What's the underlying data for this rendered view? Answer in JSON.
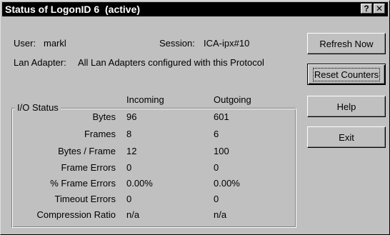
{
  "window": {
    "title": "Status of LogonID 6  (active)",
    "help_glyph": "?",
    "close_glyph": "✕"
  },
  "info": {
    "user_label": "User:",
    "user_value": "markl",
    "session_label": "Session:",
    "session_value": "ICA-ipx#10",
    "lan_label": "Lan Adapter:",
    "lan_value": "All Lan Adapters configured with this Protocol"
  },
  "io_status": {
    "title": "I/O Status",
    "col_incoming": "Incoming",
    "col_outgoing": "Outgoing",
    "rows": [
      {
        "label": "Bytes",
        "incoming": "96",
        "outgoing": "601"
      },
      {
        "label": "Frames",
        "incoming": "8",
        "outgoing": "6"
      },
      {
        "label": "Bytes / Frame",
        "incoming": "12",
        "outgoing": "100"
      },
      {
        "label": "Frame Errors",
        "incoming": "0",
        "outgoing": "0"
      },
      {
        "label": "% Frame Errors",
        "incoming": "0.00%",
        "outgoing": "0.00%"
      },
      {
        "label": "Timeout Errors",
        "incoming": "0",
        "outgoing": "0"
      },
      {
        "label": "Compression Ratio",
        "incoming": "n/a",
        "outgoing": "n/a"
      }
    ]
  },
  "buttons": {
    "refresh": "Refresh Now",
    "reset": "Reset Counters",
    "help": "Help",
    "exit": "Exit"
  }
}
